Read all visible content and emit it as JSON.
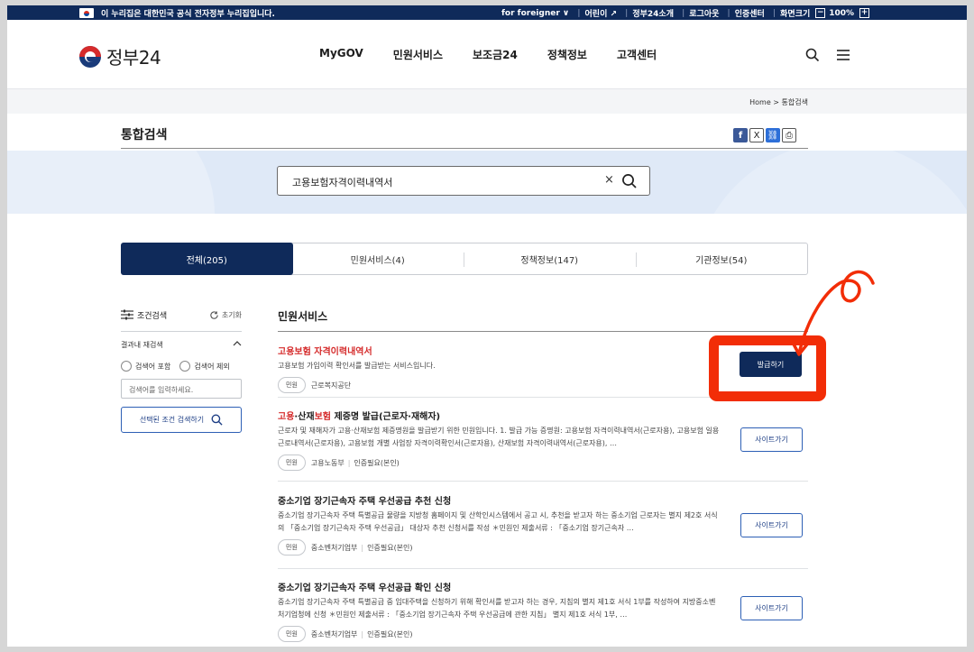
{
  "topbar": {
    "notice": "이 누리집은 대한민국 공식 전자정부 누리집입니다.",
    "links": [
      "for foreigner ∨",
      "어린이 ↗",
      "정부24소개",
      "로그아웃",
      "인증센터",
      "화면크기"
    ],
    "zoom_minus": "−",
    "zoom_value": "100%",
    "zoom_plus": "+"
  },
  "header": {
    "logo_text": "정부24",
    "nav": [
      "MyGOV",
      "민원서비스",
      "보조금24",
      "정책정보",
      "고객센터"
    ]
  },
  "breadcrumb": "Home  >  통합검색",
  "page_title": "통합검색",
  "share": {
    "facebook": "f",
    "x": "X",
    "link": "⛓",
    "print": "⎙"
  },
  "search": {
    "value": "고용보험자격이력내역서",
    "clear": "×"
  },
  "tabs": [
    {
      "label": "전체(205)",
      "active": true
    },
    {
      "label": "민원서비스(4)",
      "active": false
    },
    {
      "label": "정책정보(147)",
      "active": false
    },
    {
      "label": "기관정보(54)",
      "active": false
    }
  ],
  "sidebar": {
    "title": "조건검색",
    "reset": "초기화",
    "sub_title": "결과내 재검색",
    "radio_include": "검색어 포함",
    "radio_exclude": "검색어 제외",
    "input_placeholder": "검색어를 입력하세요.",
    "search_button": "선택된 조건 검색하기"
  },
  "results": {
    "section_title": "민원서비스",
    "items": [
      {
        "name": "고용보험 자격이력내역서",
        "desc": "고용보험 가입이력 확인서를 발급받는 서비스입니다.",
        "tag": "민원",
        "org": "근로복지공단",
        "button": "발급하기"
      },
      {
        "name_hl1": "고용",
        "name_mid": "·산재",
        "name_hl2": "보험",
        "name_rest": " 제증명 발급(근로자·재해자)",
        "desc": "근로자 및 재해자가 고용·산재보험 제증명원을 발급받기 위한 민원입니다. 1. 발급 가능 증명원: 고용보험 자격이력내역서(근로자용), 고용보험 일용근로내역서(근로자용), 고용보험 개별 사업장 자격이력확인서(근로자용), 산재보험 자격이력내역서(근로자용), …",
        "tag": "민원",
        "org": "고용노동부",
        "auth": "인증필요(본인)",
        "button": "사이트가기"
      },
      {
        "name": "중소기업 장기근속자 주택 우선공급 추천 신청",
        "desc": "중소기업 장기근속자 주택 특별공급 물량을 지방청 홈페이지 및 산학인시스템에서 공고 시, 추천을 받고자 하는 중소기업 근로자는 별지 제2호 서식의 「중소기업 장기근속자 주택 우선공급」 대상자 추천 신청서를 작성 ＊민원인 제출서류 : 「중소기업 장기근속자 …",
        "tag": "민원",
        "org": "중소벤처기업부",
        "auth": "인증필요(본인)",
        "button": "사이트가기"
      },
      {
        "name": "중소기업 장기근속자 주택 우선공급 확인 신청",
        "desc": "중소기업 장기근속자 주택 특별공급 중 임대주택을 신청하기 위해 확인서를 받고자 하는 경우, 지침의 별지 제1호 서식 1부를 작성하여 지방중소벤처기업청에 신청 ＊민원인 제출서류 : 「중소기업 장기근속자 주택 우선공급에 관한 지침」 별지 제1호 서식 1부, …",
        "tag": "민원",
        "org": "중소벤처기업부",
        "auth": "인증필요(본인)",
        "button": "사이트가기"
      }
    ]
  },
  "colors": {
    "navy": "#0f2a5a",
    "highlight": "#f22d07",
    "keyword": "#d52b2b",
    "band": "#dfe9f7"
  }
}
